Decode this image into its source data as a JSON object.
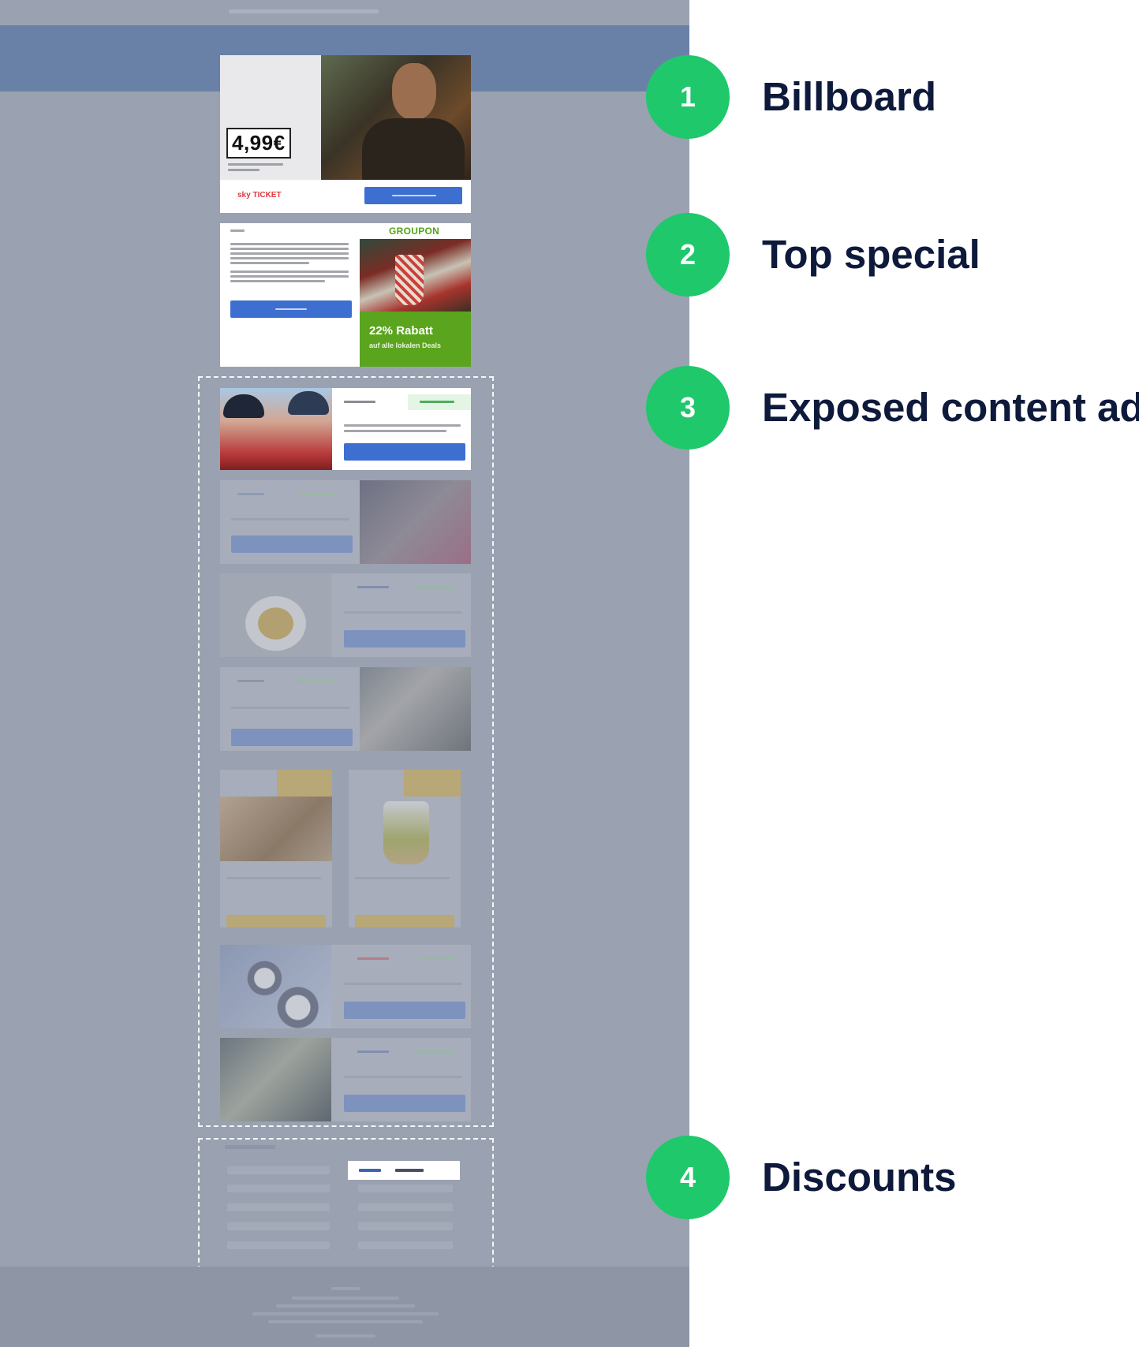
{
  "billboard": {
    "price": "4,99€",
    "brand": "sky TICKET"
  },
  "top_special": {
    "brand": "GROUPON",
    "discount": "22% Rabatt",
    "sub": "auf alle lokalen Deals"
  },
  "legend": [
    {
      "number": "1",
      "label": "Billboard"
    },
    {
      "number": "2",
      "label": "Top special"
    },
    {
      "number": "3",
      "label": "Exposed content ad"
    },
    {
      "number": "4",
      "label": "Discounts"
    }
  ],
  "colors": {
    "badge_green": "#1fc86a",
    "label_navy": "#0e1a3b",
    "header_blue": "#6a81a7",
    "cta_blue": "#3d6fd0",
    "groupon_green": "#5ba51e"
  }
}
